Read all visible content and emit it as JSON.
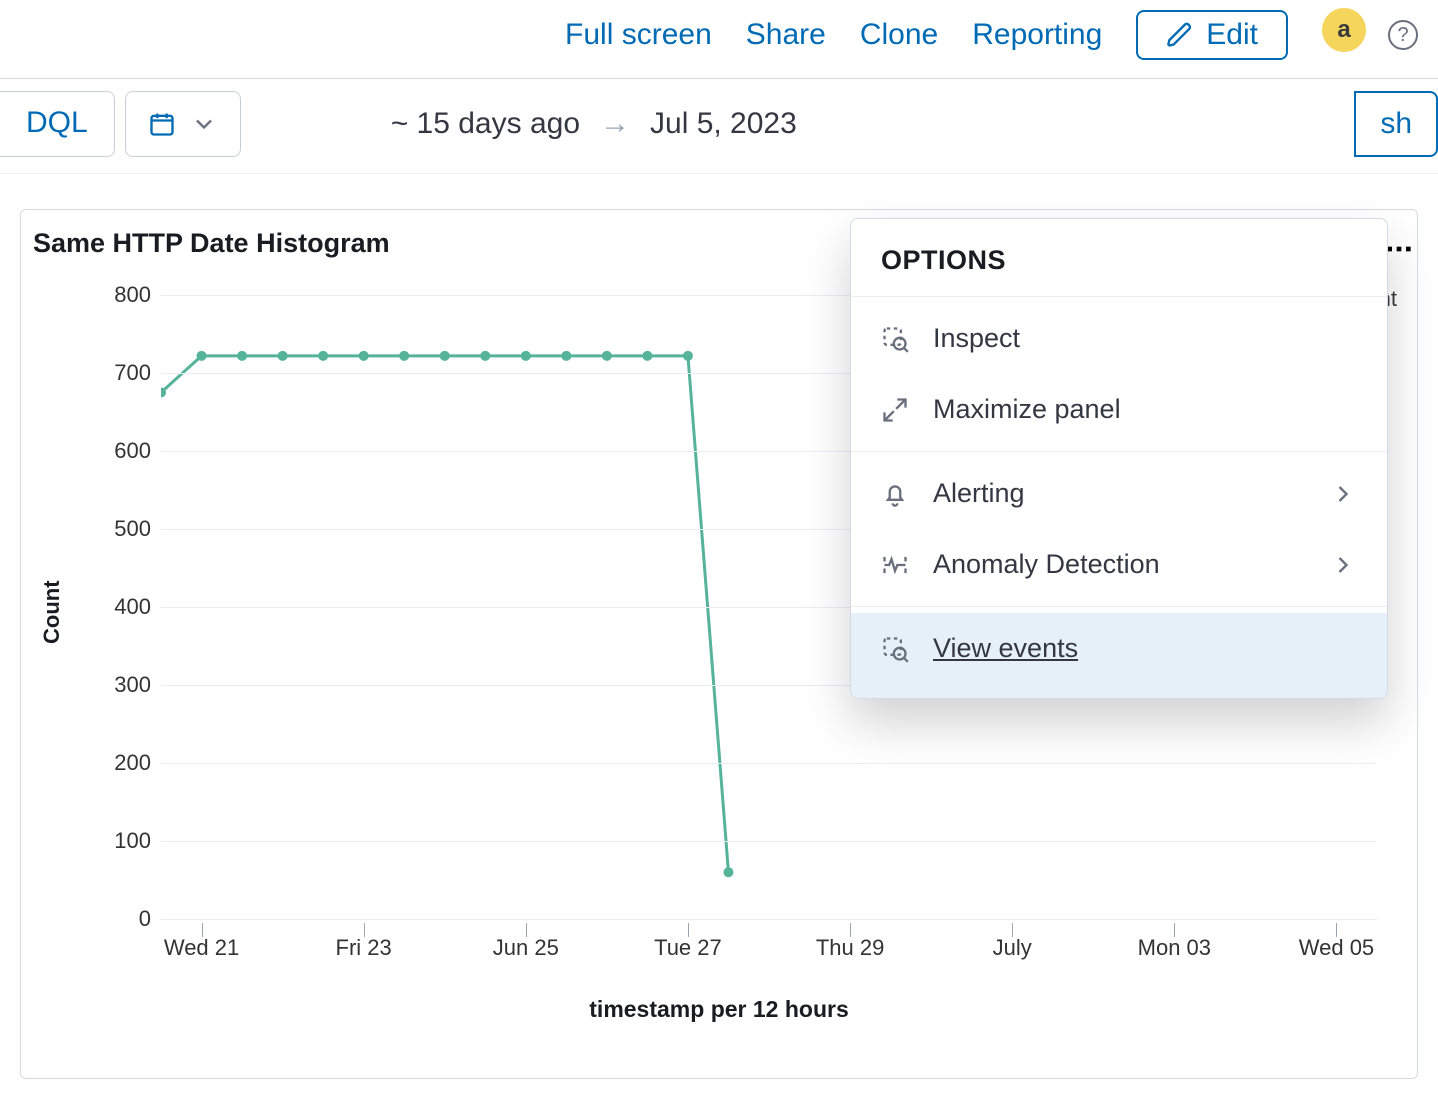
{
  "topbar": {
    "full_screen": "Full screen",
    "share": "Share",
    "clone": "Clone",
    "reporting": "Reporting",
    "edit": "Edit",
    "avatar_letter": "a"
  },
  "controls": {
    "dql_label": "DQL",
    "range_from": "~ 15 days ago",
    "range_arrow": "→",
    "range_to": "Jul 5, 2023",
    "refresh_suffix": "sh"
  },
  "panel": {
    "title": "Same HTTP Date Histogram",
    "legend_label": "ount",
    "y_axis_title": "Count",
    "x_axis_title": "timestamp per 12 hours"
  },
  "popover": {
    "header": "OPTIONS",
    "inspect": "Inspect",
    "maximize": "Maximize panel",
    "alerting": "Alerting",
    "anomaly": "Anomaly Detection",
    "view_events": "View events"
  },
  "chart_data": {
    "type": "line",
    "title": "Same HTTP Date Histogram",
    "xlabel": "timestamp per 12 hours",
    "ylabel": "Count",
    "ylim": [
      0,
      800
    ],
    "y_ticks": [
      0,
      100,
      200,
      300,
      400,
      500,
      600,
      700,
      800
    ],
    "x_tick_labels": [
      "Wed 21",
      "Fri 23",
      "Jun 25",
      "Tue 27",
      "Thu 29",
      "July",
      "Mon 03",
      "Wed 05"
    ],
    "x_tick_indices": [
      1,
      5,
      9,
      13,
      17,
      21,
      25,
      29
    ],
    "x_total_slots": 31,
    "series": [
      {
        "name": "Count",
        "color": "#54b399",
        "points": [
          {
            "i": 0,
            "y": 675
          },
          {
            "i": 1,
            "y": 722
          },
          {
            "i": 2,
            "y": 722
          },
          {
            "i": 3,
            "y": 722
          },
          {
            "i": 4,
            "y": 722
          },
          {
            "i": 5,
            "y": 722
          },
          {
            "i": 6,
            "y": 722
          },
          {
            "i": 7,
            "y": 722
          },
          {
            "i": 8,
            "y": 722
          },
          {
            "i": 9,
            "y": 722
          },
          {
            "i": 10,
            "y": 722
          },
          {
            "i": 11,
            "y": 722
          },
          {
            "i": 12,
            "y": 722
          },
          {
            "i": 13,
            "y": 722
          },
          {
            "i": 14,
            "y": 60
          }
        ]
      }
    ]
  }
}
